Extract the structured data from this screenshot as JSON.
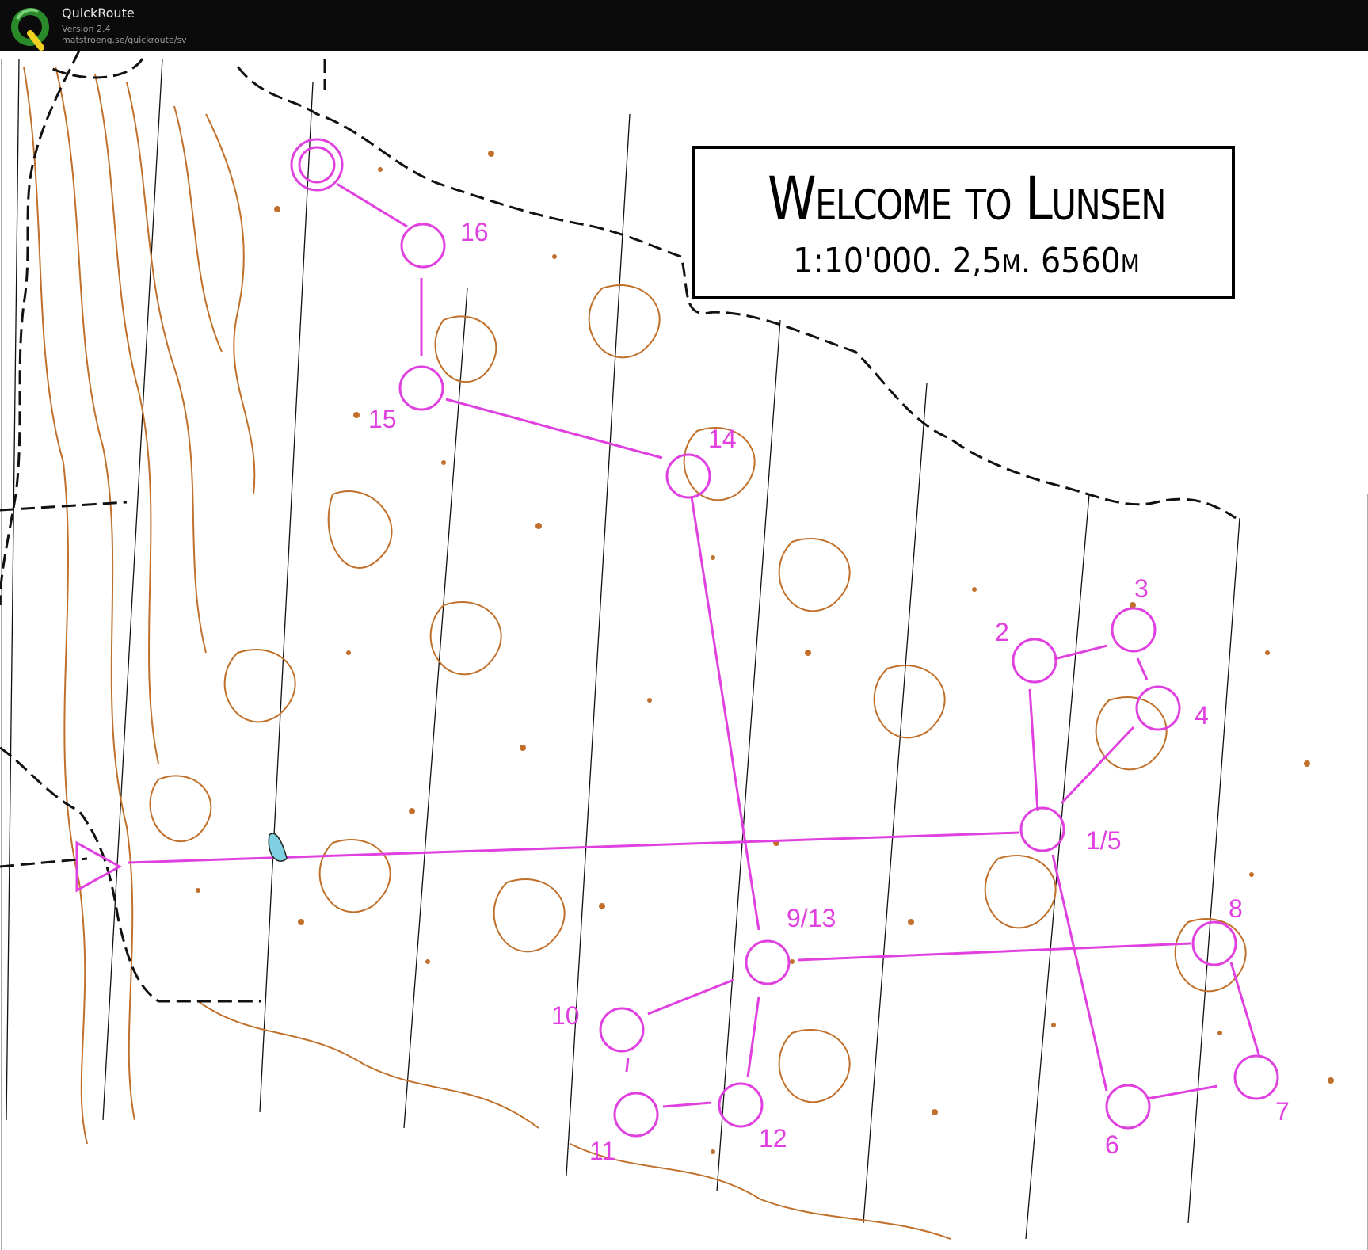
{
  "app": {
    "name": "QuickRoute",
    "version": "Version 2.4",
    "url": "matstroeng.se/quickroute/sv",
    "logo_icon": "quickroute-q-logo-icon"
  },
  "map": {
    "title": "Welcome to Lunsen",
    "subtitle": "1:10'000. 2,5m. 6560m",
    "course_color": "#e040e0",
    "contour_color": "#c0702a",
    "controls": [
      {
        "label": "16"
      },
      {
        "label": "15"
      },
      {
        "label": "14"
      },
      {
        "label": "9/13"
      },
      {
        "label": "10"
      },
      {
        "label": "11"
      },
      {
        "label": "12"
      },
      {
        "label": "1/5"
      },
      {
        "label": "2"
      },
      {
        "label": "3"
      },
      {
        "label": "4"
      },
      {
        "label": "6"
      },
      {
        "label": "7"
      },
      {
        "label": "8"
      }
    ]
  }
}
